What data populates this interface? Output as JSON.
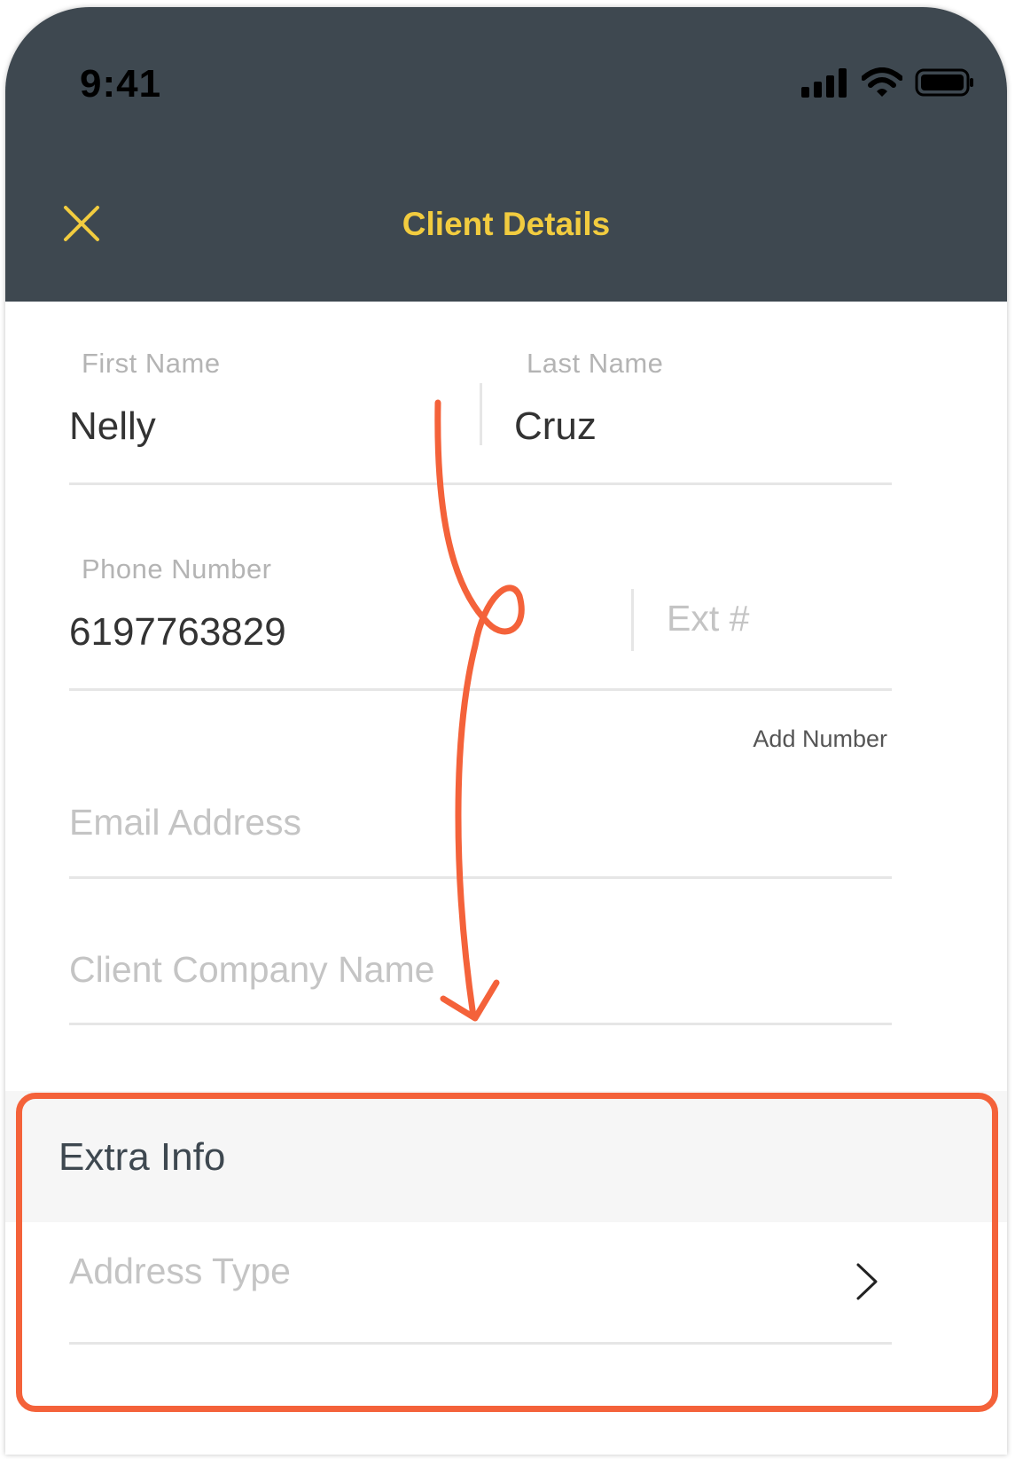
{
  "status_bar": {
    "time": "9:41",
    "icons": [
      "cellular-signal-icon",
      "wifi-icon",
      "battery-icon"
    ]
  },
  "header": {
    "title": "Client Details",
    "close_icon": "close-icon"
  },
  "form": {
    "first_name": {
      "label": "First Name",
      "value": "Nelly"
    },
    "last_name": {
      "label": "Last Name",
      "value": "Cruz"
    },
    "phone": {
      "label": "Phone Number",
      "value": "6197763829"
    },
    "ext": {
      "placeholder": "Ext #"
    },
    "add_number": "Add Number",
    "email": {
      "placeholder": "Email Address"
    },
    "company": {
      "placeholder": "Client Company Name"
    }
  },
  "extra_info": {
    "title": "Extra Info",
    "address_type": {
      "placeholder": "Address Type",
      "icon": "chevron-right-icon"
    }
  },
  "colors": {
    "header_bg": "#3e4850",
    "title": "#f2cc3f",
    "accent": "#f4623a"
  }
}
